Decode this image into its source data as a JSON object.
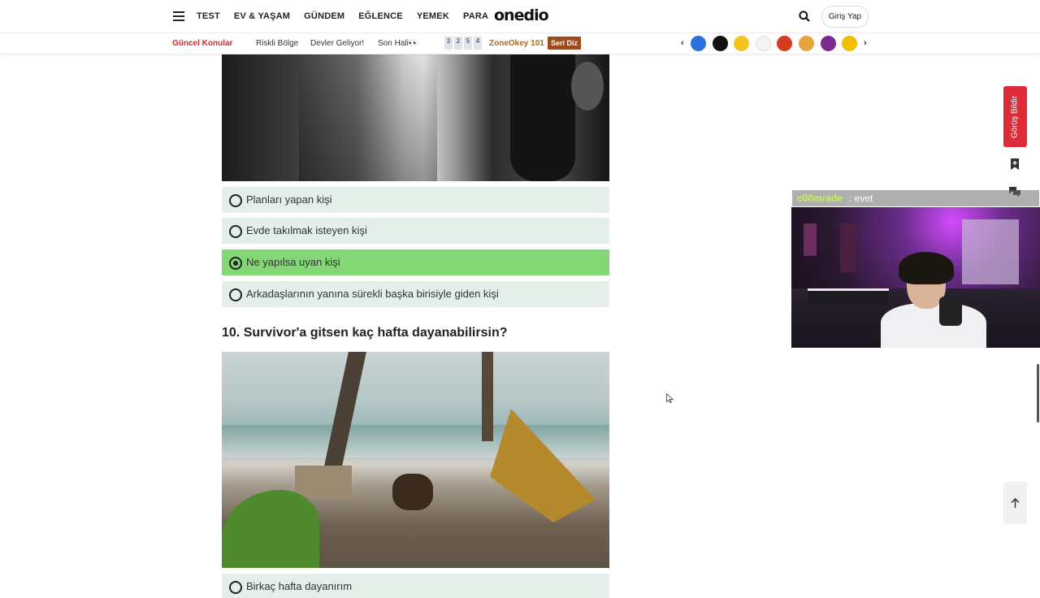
{
  "topnav": {
    "links": [
      "TEST",
      "EV & YAŞAM",
      "GÜNDEM",
      "EĞLENCE",
      "YEMEK",
      "PARA"
    ],
    "logo": "onedio",
    "login_label": "Giriş Yap"
  },
  "subnav": {
    "hot_label": "Güncel Konular",
    "items": [
      "Riskli Bölge",
      "Devler Geliyor!",
      "Son Hali👀"
    ],
    "zone_tiles": [
      "3",
      "2",
      "5",
      "4"
    ],
    "zone_label": "ZoneOkey 101",
    "series_button": "Seri Diz",
    "brand_icons": [
      "onedio-brand-icon",
      "ok-brand-icon",
      "motiv-brand-icon",
      "spark-brand-icon",
      "fire-brand-icon",
      "gold-brand-icon",
      "pink-brand-icon",
      "yellow-brand-icon"
    ]
  },
  "quiz": {
    "options": [
      {
        "label": "Planları yapan kişi",
        "selected": false
      },
      {
        "label": "Evde takılmak isteyen kişi",
        "selected": false
      },
      {
        "label": "Ne yapılsa uyan kişi",
        "selected": true
      },
      {
        "label": "Arkadaşlarının yanına sürekli başka birisiyle giden kişi",
        "selected": false
      }
    ],
    "question_title": "10. Survivor'a gitsen kaç hafta dayanabilirsin?",
    "next_option_partial": "Birkaç hafta dayanırım"
  },
  "sidebar": {
    "feedback_label": "Görüş Bildir"
  },
  "stream": {
    "chat_user": "c00mrade",
    "chat_message": ": evet"
  },
  "colors": {
    "accent_red": "#dd2b37",
    "option_bg": "#e4efe9",
    "option_selected_bg": "#84d775",
    "zone_label": "#b06a10",
    "series_button_bg": "#9c4b1c"
  }
}
